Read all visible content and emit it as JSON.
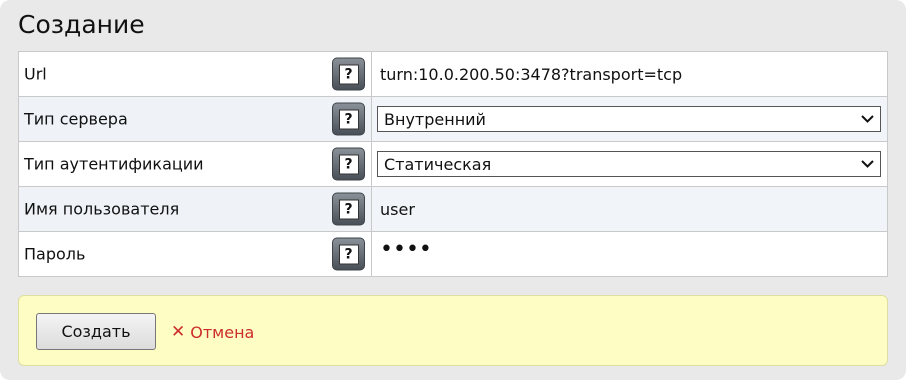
{
  "page": {
    "title": "Создание"
  },
  "form": {
    "rows": [
      {
        "label": "Url",
        "value": "turn:10.0.200.50:3478?transport=tcp",
        "kind": "text"
      },
      {
        "label": "Тип сервера",
        "value": "Внутренний",
        "kind": "select"
      },
      {
        "label": "Тип аутентификации",
        "value": "Статическая",
        "kind": "select"
      },
      {
        "label": "Имя пользователя",
        "value": "user",
        "kind": "text"
      },
      {
        "label": "Пароль",
        "value": "••••",
        "kind": "password"
      }
    ],
    "help_icon": "question-mark-icon"
  },
  "actions": {
    "create_label": "Создать",
    "cancel_label": "Отмена",
    "cancel_icon_glyph": "✕",
    "cancel_color": "#cc2d2d",
    "bar_color": "#fdfdc4"
  }
}
